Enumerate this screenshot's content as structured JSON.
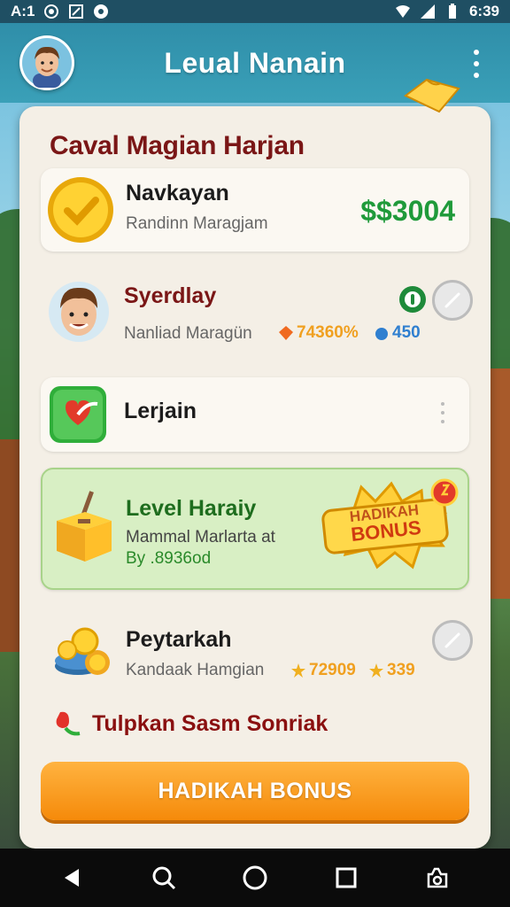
{
  "status_bar": {
    "left_text": "A:1",
    "time": "6:39"
  },
  "app_bar": {
    "title": "Leual Nanain"
  },
  "panel": {
    "title": "Caval Magian Harjan"
  },
  "cards": [
    {
      "name": "Navkayan",
      "subtitle": "Randinn Maragjam",
      "amount": "$$3004",
      "icon": "gold-check-coin-icon"
    },
    {
      "name": "Syerdlay",
      "subtitle": "Nanliad Maragün",
      "stat_1": "74360%",
      "stat_2": "450",
      "icon": "avatar"
    },
    {
      "name": "Lerjain",
      "icon": "heart-app-icon"
    },
    {
      "name": "Level Haraiy",
      "subtitle": "Mammal Marlarta at",
      "subtitle_2": "By .8936od",
      "badge_line1": "HADIKAH",
      "badge_line2": "BONUS",
      "icon": "yellow-box-icon"
    },
    {
      "name": "Peytarkah",
      "subtitle": "Kandaak Hamgian",
      "stat_1": "72909",
      "stat_2": "339",
      "icon": "coin-pile-icon"
    }
  ],
  "footer": {
    "text": "Tulpkan Sasm Sonriak"
  },
  "bonus_button": {
    "label": "HADIKAH BONUS"
  },
  "colors": {
    "accent_orange": "#f58a0a",
    "title_maroon": "#7a1616",
    "money_green": "#1f9a3a",
    "app_bar_teal": "#2f8ea9"
  }
}
